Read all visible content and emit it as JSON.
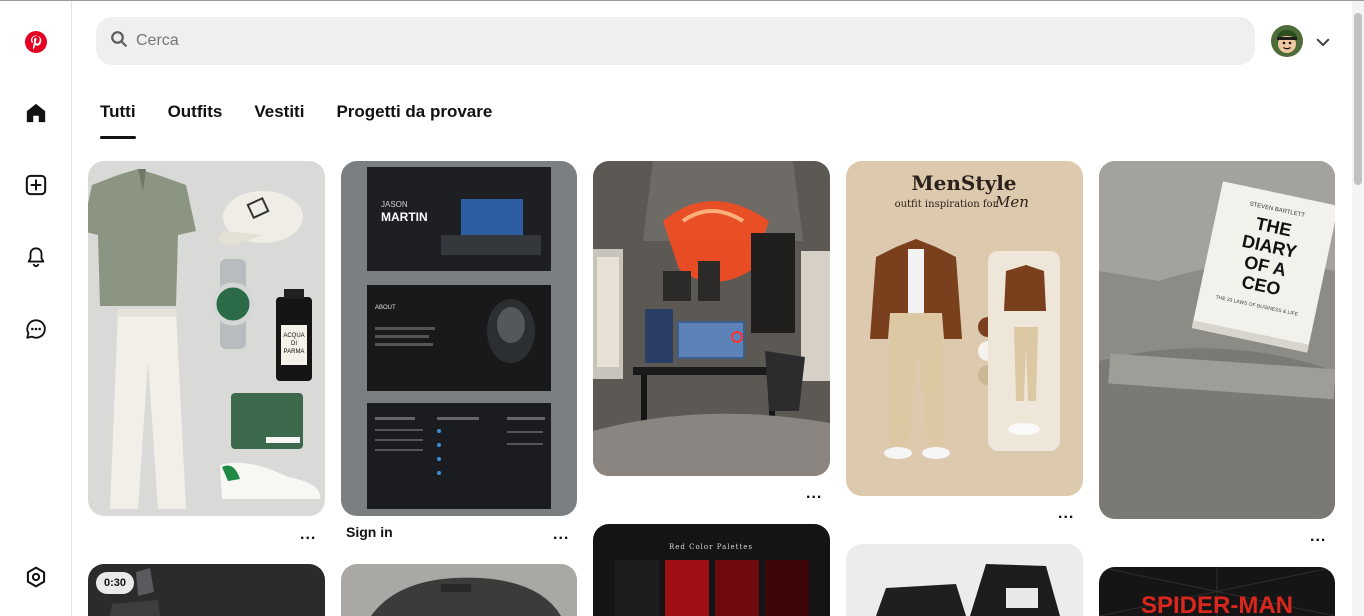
{
  "search": {
    "placeholder": "Cerca"
  },
  "tabs": [
    {
      "label": "Tutti",
      "active": true
    },
    {
      "label": "Outfits",
      "active": false
    },
    {
      "label": "Vestiti",
      "active": false
    },
    {
      "label": "Progetti da provare",
      "active": false
    }
  ],
  "sidebar": {
    "items": [
      {
        "icon": "pinterest-logo-icon"
      },
      {
        "icon": "home-icon"
      },
      {
        "icon": "create-icon"
      },
      {
        "icon": "notifications-bell-icon"
      },
      {
        "icon": "messages-icon"
      },
      {
        "icon": "settings-icon"
      }
    ]
  },
  "pins": {
    "p2_title": "Sign in",
    "more_label": "...",
    "video_duration": "0:30",
    "portfolio_name_first": "JASON",
    "portfolio_name_last": "MARTIN",
    "portfolio_about": "ABOUT",
    "menstyle_title": "MenStyle",
    "menstyle_sub": "outfit inspiration for",
    "menstyle_sub_script": "Men",
    "book_line1": "THE",
    "book_line2": "DIARY",
    "book_line3": "OF A",
    "book_line4": "CEO",
    "book_author": "STEVEN BARTLETT",
    "book_tag": "THE 33 LAWS OF BUSINESS & LIFE",
    "palette_title": "Red Color Palettes",
    "spider_text": "SPIDER-MAN",
    "perfume_line1": "ACQUA",
    "perfume_line2": "DI",
    "perfume_line3": "PARMA"
  },
  "colors": {
    "brand": "#e60023",
    "search_bg": "#efefef",
    "text": "#111111"
  }
}
